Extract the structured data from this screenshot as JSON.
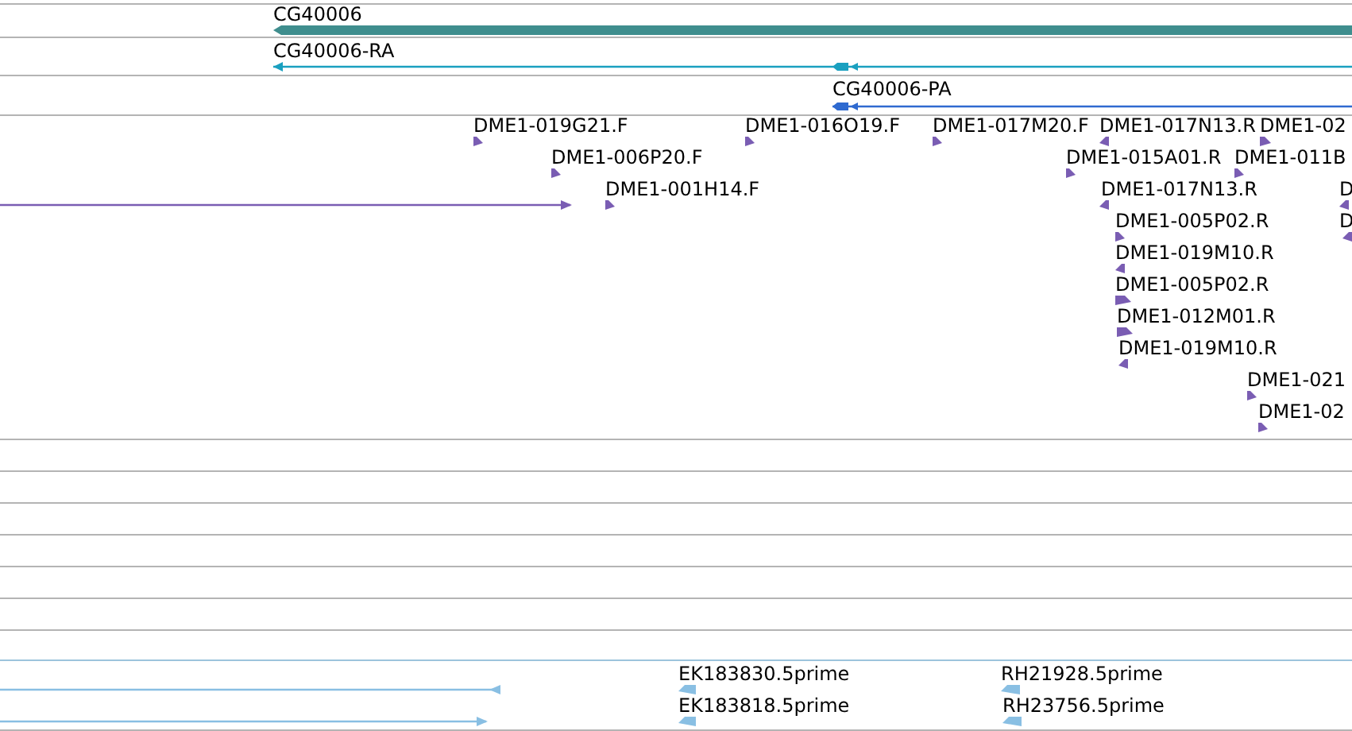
{
  "tracks": [
    {
      "kind": "gene",
      "color": "#3f8e8e",
      "features": [
        {
          "label": "CG40006",
          "reverse": true
        }
      ]
    },
    {
      "kind": "transcript",
      "color": "#1aa0c0",
      "features": [
        {
          "label": "CG40006-RA",
          "reverse": true
        }
      ]
    },
    {
      "kind": "protein",
      "color": "#2f6ad0",
      "features": [
        {
          "label": "CG40006-PA",
          "reverse": true
        }
      ]
    },
    {
      "kind": "read",
      "color": "#7a5db3",
      "features": [
        {
          "label": "DME1-019G21.F",
          "reverse": false
        },
        {
          "label": "DME1-016O19.F",
          "reverse": false
        },
        {
          "label": "DME1-017M20.F",
          "reverse": false
        },
        {
          "label": "DME1-017N13.R",
          "reverse": true
        },
        {
          "label": "DME1-02",
          "reverse": false
        },
        {
          "label": "DME1-006P20.F",
          "reverse": false
        },
        {
          "label": "DME1-015A01.R",
          "reverse": false
        },
        {
          "label": "DME1-011B",
          "reverse": false
        },
        {
          "reverse": false
        },
        {
          "label": "DME1-001H14.F",
          "reverse": false
        },
        {
          "label": "DME1-017N13.R",
          "reverse": true
        },
        {
          "label": "D",
          "reverse": true
        },
        {
          "label": "DME1-005P02.R",
          "reverse": false
        },
        {
          "label": "D",
          "reverse": true
        },
        {
          "label": "DME1-019M10.R",
          "reverse": true
        },
        {
          "label": "DME1-005P02.R",
          "reverse": false
        },
        {
          "label": "DME1-012M01.R",
          "reverse": false
        },
        {
          "label": "DME1-019M10.R",
          "reverse": true
        },
        {
          "label": "DME1-021",
          "reverse": false
        },
        {
          "label": "DME1-02",
          "reverse": false
        }
      ]
    },
    {
      "kind": "read",
      "color": "#89bfe3",
      "features": [
        {
          "reverse": true
        },
        {
          "label": "EK183830.5prime",
          "reverse": true
        },
        {
          "label": "RH21928.5prime",
          "reverse": true
        },
        {
          "reverse": false
        },
        {
          "label": "EK183818.5prime",
          "reverse": true
        },
        {
          "label": "RH23756.5prime",
          "reverse": true
        }
      ]
    }
  ]
}
